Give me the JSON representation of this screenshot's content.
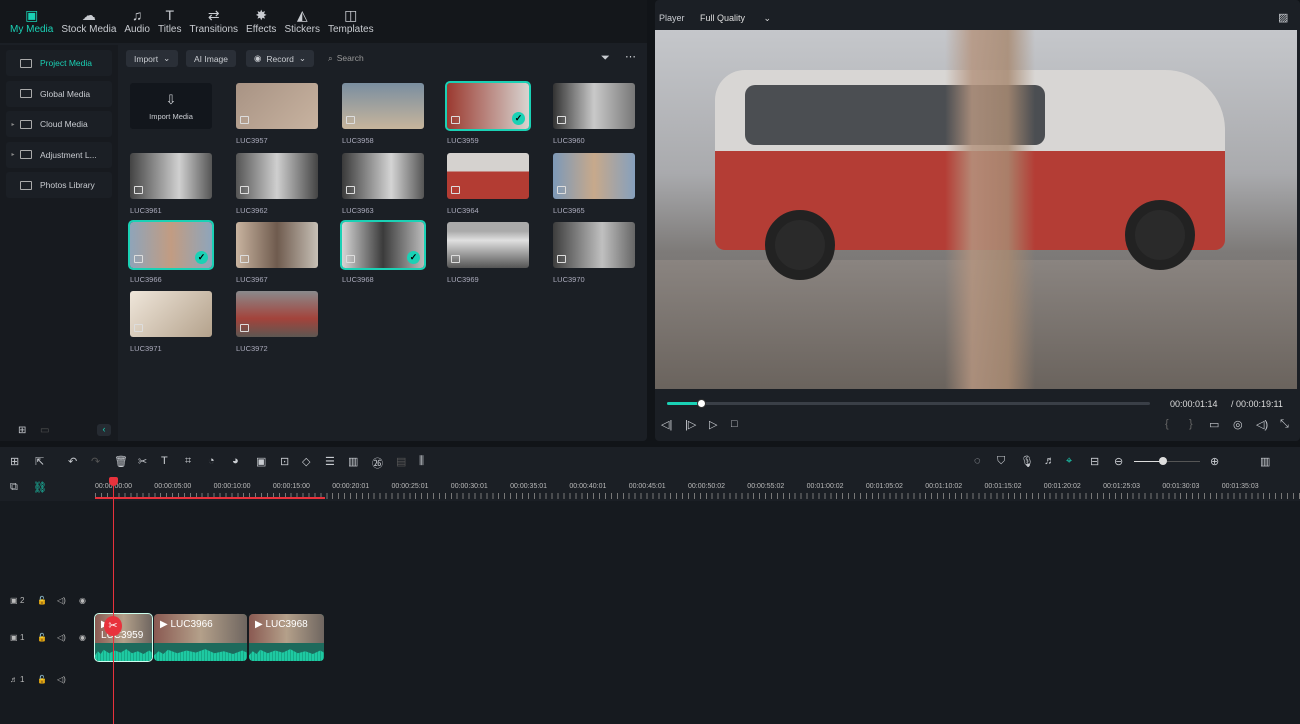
{
  "tabs": [
    {
      "label": "My Media",
      "icon": "media-icon",
      "active": true
    },
    {
      "label": "Stock Media",
      "icon": "cloud-icon"
    },
    {
      "label": "Audio",
      "icon": "music-icon"
    },
    {
      "label": "Titles",
      "icon": "text-icon"
    },
    {
      "label": "Transitions",
      "icon": "transition-icon"
    },
    {
      "label": "Effects",
      "icon": "effects-icon"
    },
    {
      "label": "Stickers",
      "icon": "sticker-icon"
    },
    {
      "label": "Templates",
      "icon": "template-icon"
    }
  ],
  "sidebar": {
    "items": [
      {
        "label": "Project Media",
        "active": true
      },
      {
        "label": "Global Media"
      },
      {
        "label": "Cloud Media",
        "expandable": true
      },
      {
        "label": "Adjustment L...",
        "expandable": true
      },
      {
        "label": "Photos Library"
      }
    ]
  },
  "media_toolbar": {
    "import": "Import",
    "ai_image": "AI Image",
    "record": "Record",
    "search_placeholder": "Search"
  },
  "import_media": "Import Media",
  "media": [
    {
      "name": "LUC3957"
    },
    {
      "name": "LUC3958"
    },
    {
      "name": "LUC3959",
      "selected": true
    },
    {
      "name": "LUC3960"
    },
    {
      "name": "LUC3961"
    },
    {
      "name": "LUC3962"
    },
    {
      "name": "LUC3963"
    },
    {
      "name": "LUC3964"
    },
    {
      "name": "LUC3965"
    },
    {
      "name": "LUC3966",
      "selected": true
    },
    {
      "name": "LUC3967"
    },
    {
      "name": "LUC3968",
      "selected": true
    },
    {
      "name": "LUC3969"
    },
    {
      "name": "LUC3970"
    },
    {
      "name": "LUC3971"
    },
    {
      "name": "LUC3972"
    }
  ],
  "player": {
    "label": "Player",
    "quality": "Full Quality",
    "current_time": "00:00:01:14",
    "total_time": "/ 00:00:19:11",
    "progress": 0.07
  },
  "ruler": [
    "00:00:00:00",
    "00:00:05:00",
    "00:00:10:00",
    "00:00:15:00",
    "00:00:20:01",
    "00:00:25:01",
    "00:00:30:01",
    "00:00:35:01",
    "00:00:40:01",
    "00:00:45:01",
    "00:00:50:02",
    "00:00:55:02",
    "00:01:00:02",
    "00:01:05:02",
    "00:01:10:02",
    "00:01:15:02",
    "00:01:20:02",
    "00:01:25:03",
    "00:01:30:03",
    "00:01:35:03"
  ],
  "tracks": [
    {
      "label": "2",
      "type": "video"
    },
    {
      "label": "1",
      "type": "video"
    },
    {
      "label": "1",
      "type": "audio"
    }
  ],
  "clips": [
    {
      "name": "LUC3959"
    },
    {
      "name": "LUC3966"
    },
    {
      "name": "LUC3968"
    }
  ],
  "colors": {
    "accent": "#1ad1b5",
    "playhead": "#e8323c"
  }
}
